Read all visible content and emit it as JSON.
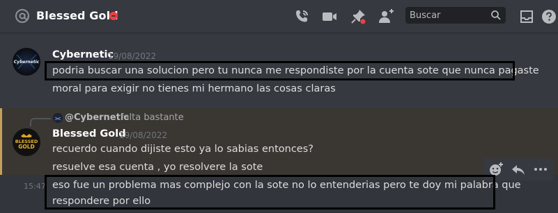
{
  "header": {
    "channel_title": "Blessed Gold",
    "search_placeholder": "Buscar"
  },
  "messages": [
    {
      "author": "Cybernetic",
      "timestamp": "19/08/2022",
      "avatar_text": "Cybernetic",
      "lines": [
        "podria buscar una solucion pero tu nunca me respondiste por la cuenta sote que nunca pagaste",
        "moral para exigir no tienes mi hermano las cosas claras"
      ]
    },
    {
      "reply_to_author": "@Cybernetic",
      "reply_snippet": "falta bastante",
      "author": "Blessed Gold",
      "timestamp": "19/08/2022",
      "avatar_text_1": "BLESSED",
      "avatar_text_2": "GOLD",
      "lines": [
        "recuerdo cuando dijiste esto ya lo sabias entonces?",
        "resuelve esa cuenta , yo resolvere la sote"
      ]
    },
    {
      "hover_time": "15:47",
      "lines": [
        "eso fue un problema mas complejo con la sote no lo entenderias pero te doy mi palabra que",
        "respondere por ello"
      ]
    }
  ],
  "colors": {
    "background": "#36393f",
    "reply_highlight": "#c4a15a",
    "status_dnd": "#ed4245"
  }
}
